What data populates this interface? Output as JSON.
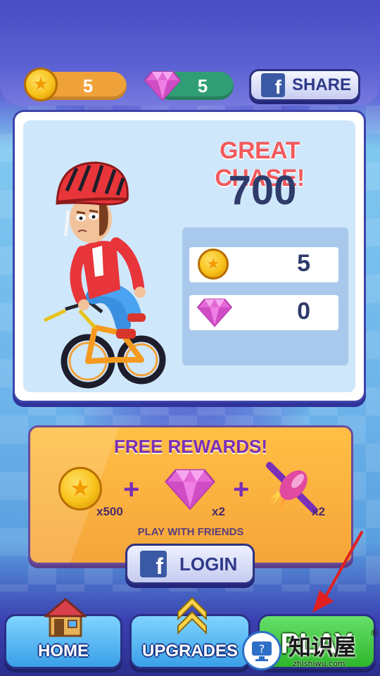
{
  "header": {
    "coins": "5",
    "gems": "5",
    "share_label": "SHARE",
    "fb_glyph": "f"
  },
  "result": {
    "title": "GREAT CHASE!",
    "score": "700",
    "rewards": [
      {
        "icon": "coin-icon",
        "value": "5"
      },
      {
        "icon": "gem-icon",
        "value": "0"
      }
    ]
  },
  "free_rewards": {
    "title": "FREE REWARDS!",
    "items": [
      {
        "icon": "coin-icon",
        "multiplier": "x500"
      },
      {
        "icon": "gem-icon",
        "multiplier": "x2"
      },
      {
        "icon": "rocket-icon",
        "multiplier": "x2"
      }
    ],
    "plus": "+",
    "subtitle": "PLAY WITH FRIENDS",
    "login_label": "LOGIN"
  },
  "nav": {
    "home": "HOME",
    "upgrades": "UPGRADES",
    "play": "PLAY"
  },
  "watermark": {
    "text": "知识屋",
    "sub": "zhishiwu.com",
    "mark": "®"
  },
  "colors": {
    "title_red": "#f05a5e",
    "score_navy": "#2f3b6a",
    "free_title_purple": "#7a2fb8",
    "coin_gold": "#f7c21a",
    "gem_pink": "#e467d6",
    "play_green": "#2fb52c",
    "nav_blue": "#3a9fe8",
    "arrow_red": "#e02020"
  }
}
